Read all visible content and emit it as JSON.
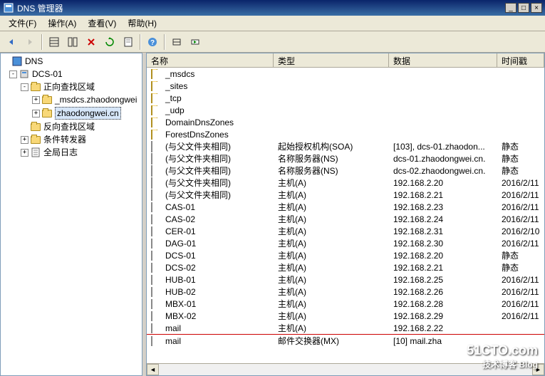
{
  "window": {
    "title": "DNS 管理器",
    "min": "_",
    "max": "□",
    "close": "×"
  },
  "menu": {
    "file": "文件(F)",
    "action": "操作(A)",
    "view": "查看(V)",
    "help": "帮助(H)"
  },
  "tree": {
    "root": "DNS",
    "server": "DCS-01",
    "fwd_zones": "正向查找区域",
    "zone_msdcs": "_msdcs.zhaodongwei",
    "zone_main": "zhaodongwei.cn",
    "rev_zones": "反向查找区域",
    "cond_fwd": "条件转发器",
    "global_log": "全局日志"
  },
  "columns": {
    "name": "名称",
    "type": "类型",
    "data": "数据",
    "time": "时间戳"
  },
  "rows": [
    {
      "icon": "folder",
      "name": "_msdcs",
      "type": "",
      "data": "",
      "time": ""
    },
    {
      "icon": "folder",
      "name": "_sites",
      "type": "",
      "data": "",
      "time": ""
    },
    {
      "icon": "folder",
      "name": "_tcp",
      "type": "",
      "data": "",
      "time": ""
    },
    {
      "icon": "folder",
      "name": "_udp",
      "type": "",
      "data": "",
      "time": ""
    },
    {
      "icon": "folder",
      "name": "DomainDnsZones",
      "type": "",
      "data": "",
      "time": ""
    },
    {
      "icon": "folder",
      "name": "ForestDnsZones",
      "type": "",
      "data": "",
      "time": ""
    },
    {
      "icon": "rec",
      "name": "(与父文件夹相同)",
      "type": "起始授权机构(SOA)",
      "data": "[103], dcs-01.zhaodon...",
      "time": "静态"
    },
    {
      "icon": "rec",
      "name": "(与父文件夹相同)",
      "type": "名称服务器(NS)",
      "data": "dcs-01.zhaodongwei.cn.",
      "time": "静态"
    },
    {
      "icon": "rec",
      "name": "(与父文件夹相同)",
      "type": "名称服务器(NS)",
      "data": "dcs-02.zhaodongwei.cn.",
      "time": "静态"
    },
    {
      "icon": "rec",
      "name": "(与父文件夹相同)",
      "type": "主机(A)",
      "data": "192.168.2.20",
      "time": "2016/2/11"
    },
    {
      "icon": "rec",
      "name": "(与父文件夹相同)",
      "type": "主机(A)",
      "data": "192.168.2.21",
      "time": "2016/2/11"
    },
    {
      "icon": "rec",
      "name": "CAS-01",
      "type": "主机(A)",
      "data": "192.168.2.23",
      "time": "2016/2/11"
    },
    {
      "icon": "rec",
      "name": "CAS-02",
      "type": "主机(A)",
      "data": "192.168.2.24",
      "time": "2016/2/11"
    },
    {
      "icon": "rec",
      "name": "CER-01",
      "type": "主机(A)",
      "data": "192.168.2.31",
      "time": "2016/2/10"
    },
    {
      "icon": "rec",
      "name": "DAG-01",
      "type": "主机(A)",
      "data": "192.168.2.30",
      "time": "2016/2/11"
    },
    {
      "icon": "rec",
      "name": "DCS-01",
      "type": "主机(A)",
      "data": "192.168.2.20",
      "time": "静态"
    },
    {
      "icon": "rec",
      "name": "DCS-02",
      "type": "主机(A)",
      "data": "192.168.2.21",
      "time": "静态"
    },
    {
      "icon": "rec",
      "name": "HUB-01",
      "type": "主机(A)",
      "data": "192.168.2.25",
      "time": "2016/2/11"
    },
    {
      "icon": "rec",
      "name": "HUB-02",
      "type": "主机(A)",
      "data": "192.168.2.26",
      "time": "2016/2/11"
    },
    {
      "icon": "rec",
      "name": "MBX-01",
      "type": "主机(A)",
      "data": "192.168.2.28",
      "time": "2016/2/11"
    },
    {
      "icon": "rec",
      "name": "MBX-02",
      "type": "主机(A)",
      "data": "192.168.2.29",
      "time": "2016/2/11"
    },
    {
      "icon": "rec",
      "name": "mail",
      "type": "主机(A)",
      "data": "192.168.2.22",
      "time": "",
      "redline": "after"
    },
    {
      "icon": "rec",
      "name": "mail",
      "type": "邮件交换器(MX)",
      "data": "[10]  mail.zha",
      "time": ""
    }
  ],
  "watermark": {
    "brand": "51CTO.com",
    "sub": "技术博客  Blog"
  }
}
